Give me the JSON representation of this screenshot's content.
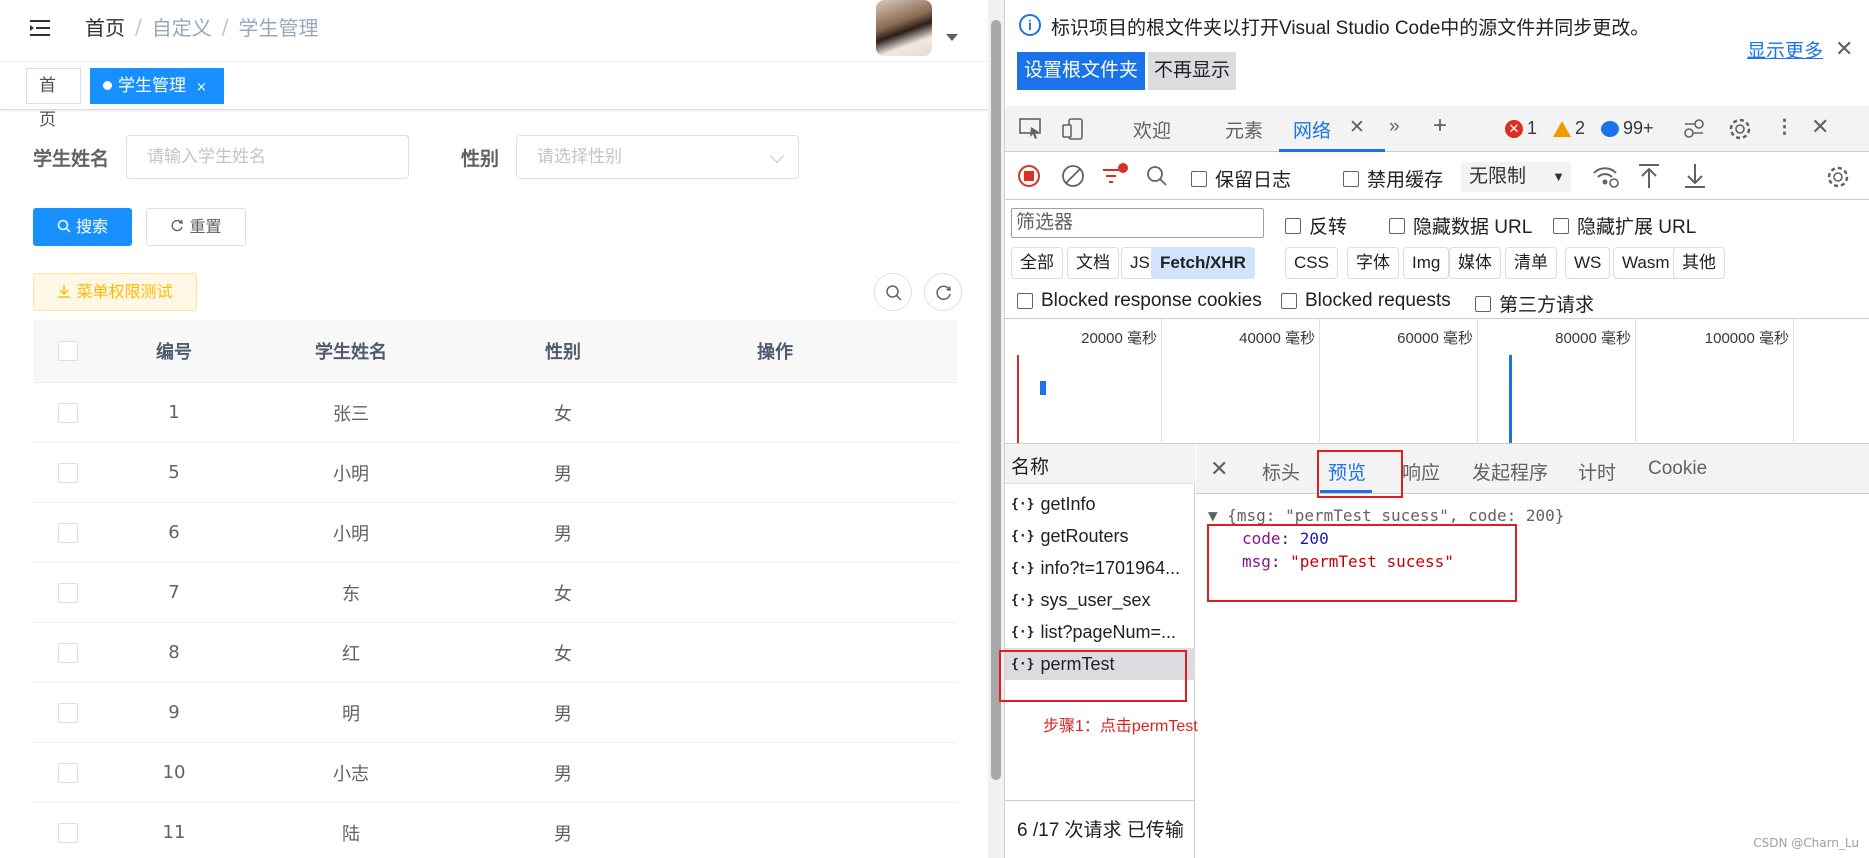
{
  "app": {
    "breadcrumb": [
      "首页",
      "自定义",
      "学生管理"
    ],
    "breadcrumb_sep": "/",
    "tags": {
      "home": "首页",
      "active": "学生管理",
      "close": "×"
    },
    "search": {
      "name_label": "学生姓名",
      "name_placeholder": "请输入学生姓名",
      "gender_label": "性别",
      "gender_placeholder": "请选择性别",
      "search_btn": "搜索",
      "reset_btn": "重置",
      "perm_btn": "菜单权限测试"
    },
    "table": {
      "headers": [
        "编号",
        "学生姓名",
        "性别",
        "操作"
      ],
      "rows": [
        {
          "id": "1",
          "name": "张三",
          "gender": "女"
        },
        {
          "id": "5",
          "name": "小明",
          "gender": "男"
        },
        {
          "id": "6",
          "name": "小明",
          "gender": "男"
        },
        {
          "id": "7",
          "name": "东",
          "gender": "女"
        },
        {
          "id": "8",
          "name": "红",
          "gender": "女"
        },
        {
          "id": "9",
          "name": "明",
          "gender": "男"
        },
        {
          "id": "10",
          "name": "小志",
          "gender": "男"
        },
        {
          "id": "11",
          "name": "陆",
          "gender": "男"
        }
      ]
    }
  },
  "devtools": {
    "info_bar": {
      "message": "标识项目的根文件夹以打开Visual Studio Code中的源文件并同步更改。",
      "primary_btn": "设置根文件夹",
      "secondary_btn": "不再显示",
      "show_more": "显示更多"
    },
    "tabs": [
      "欢迎",
      "元素",
      "网络"
    ],
    "counters": {
      "errors": "1",
      "warnings": "2",
      "messages": "99+"
    },
    "toolbar": {
      "preserve_log": "保留日志",
      "disable_cache": "禁用缓存",
      "throttle": "无限制"
    },
    "filter": {
      "placeholder": "筛选器",
      "invert": "反转",
      "hide_data_urls": "隐藏数据 URL",
      "hide_ext_urls": "隐藏扩展 URL"
    },
    "type_filters": [
      "全部",
      "文档",
      "JS",
      "Fetch/XHR",
      "CSS",
      "字体",
      "Img",
      "媒体",
      "清单",
      "WS",
      "Wasm",
      "其他"
    ],
    "selected_type": "Fetch/XHR",
    "blocked": {
      "cookies": "Blocked response cookies",
      "requests": "Blocked requests",
      "third_party": "第三方请求"
    },
    "timeline_labels": [
      "20000 毫秒",
      "40000 毫秒",
      "60000 毫秒",
      "80000 毫秒",
      "100000 毫秒"
    ],
    "name_header": "名称",
    "requests": [
      "getInfo",
      "getRouters",
      "info?t=1701964...",
      "sys_user_sex",
      "list?pageNum=...",
      "permTest"
    ],
    "selected_request": "permTest",
    "status": "6 /17 次请求  已传输",
    "detail_tabs": [
      "标头",
      "预览",
      "响应",
      "发起程序",
      "计时",
      "Cookie"
    ],
    "active_detail_tab": "预览",
    "preview": {
      "summary": "{msg: \"permTest sucess\", code: 200}",
      "code_key": "code",
      "code_val": "200",
      "msg_key": "msg",
      "msg_val": "\"permTest sucess\""
    }
  },
  "annotation": "步骤1：点击permTest",
  "watermark": "CSDN @Charn_Lu",
  "colors": {
    "primary": "#1890ff",
    "devtools_blue": "#1a73e8",
    "annot_red": "#e02020"
  }
}
